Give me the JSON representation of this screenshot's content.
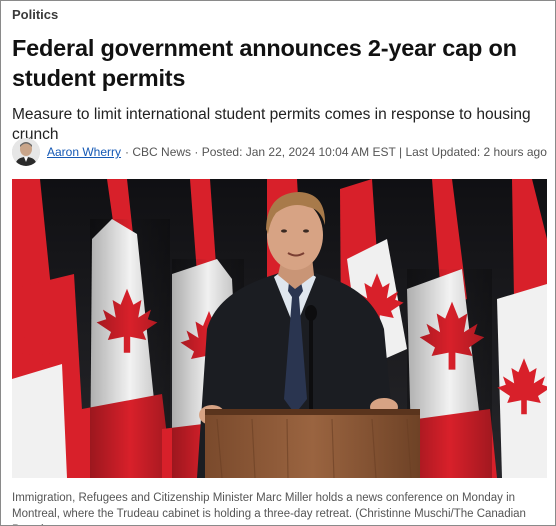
{
  "article": {
    "section": "Politics",
    "headline": "Federal government announces 2-year cap on student permits",
    "dek": "Measure to limit international student permits comes in response to housing crunch",
    "byline": {
      "author": "Aaron Wherry",
      "outlet": "· CBC News ·",
      "posted": "Posted: Jan 22, 2024 10:04 AM EST",
      "separator": "|",
      "updated": "Last Updated: 2 hours ago"
    },
    "photo": {
      "caption": "Immigration, Refugees and Citizenship Minister Marc Miller holds a news conference on Monday in Montreal, where the Trudeau cabinet is holding a three-day retreat. (Christinne Muschi/The Canadian Press)"
    }
  },
  "colors": {
    "flag_red": "#d8202a",
    "author_link": "#1559b5",
    "background": "#1c1c1f"
  }
}
